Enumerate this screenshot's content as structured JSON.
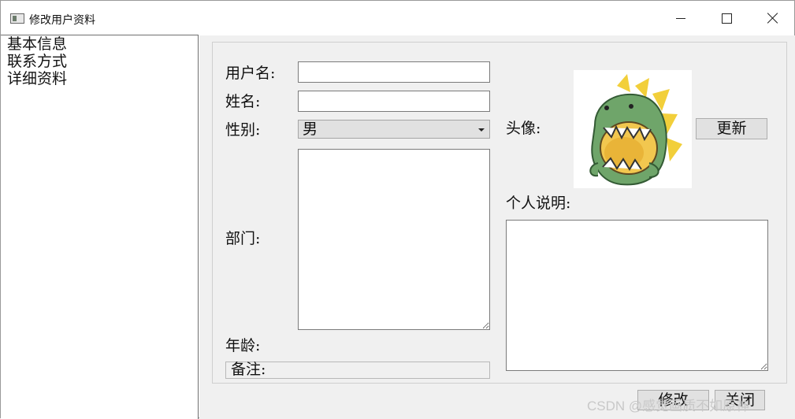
{
  "window": {
    "title": "修改用户资料"
  },
  "sidebar": {
    "items": [
      {
        "label": "基本信息"
      },
      {
        "label": "联系方式"
      },
      {
        "label": "详细资料"
      }
    ]
  },
  "form": {
    "username_label": "用户名:",
    "username_value": "",
    "name_label": "姓名:",
    "name_value": "",
    "gender_label": "性别:",
    "gender_value": "男",
    "department_label": "部门:",
    "department_value": "",
    "age_label": "年龄:",
    "note_label": "备注:",
    "avatar_label": "头像:",
    "update_button": "更新",
    "profile_label": "个人说明:",
    "profile_value": ""
  },
  "footer": {
    "modify_button": "修改",
    "close_button": "关闭",
    "watermark": "CSDN @感觉画质不如原神"
  },
  "colors": {
    "window_bg": "#f0f0f0",
    "panel_border": "#cfcfcf",
    "avatar_green": "#6fa56a",
    "avatar_yellow": "#f2cf3a"
  }
}
